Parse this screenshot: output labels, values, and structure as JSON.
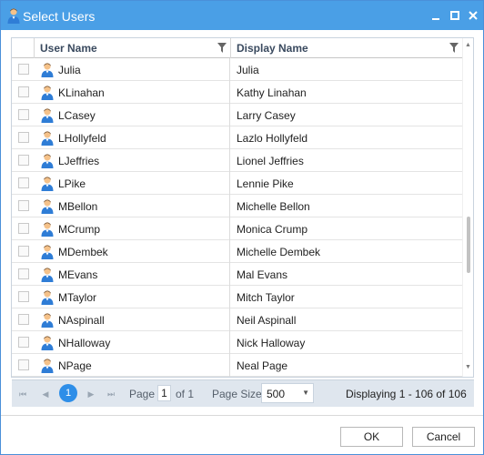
{
  "window": {
    "title": "Select Users"
  },
  "grid": {
    "columns": {
      "user_name": "User Name",
      "display_name": "Display Name"
    },
    "rows": [
      {
        "user": "Julia",
        "display": "Julia"
      },
      {
        "user": "KLinahan",
        "display": "Kathy Linahan"
      },
      {
        "user": "LCasey",
        "display": "Larry Casey"
      },
      {
        "user": "LHollyfeld",
        "display": "Lazlo Hollyfeld"
      },
      {
        "user": "LJeffries",
        "display": "Lionel Jeffries"
      },
      {
        "user": "LPike",
        "display": "Lennie Pike"
      },
      {
        "user": "MBellon",
        "display": "Michelle Bellon"
      },
      {
        "user": "MCrump",
        "display": "Monica Crump"
      },
      {
        "user": "MDembek",
        "display": "Michelle Dembek"
      },
      {
        "user": "MEvans",
        "display": "Mal Evans"
      },
      {
        "user": "MTaylor",
        "display": "Mitch Taylor"
      },
      {
        "user": "NAspinall",
        "display": "Neil Aspinall"
      },
      {
        "user": "NHalloway",
        "display": "Nick Halloway"
      },
      {
        "user": "NPage",
        "display": "Neal Page"
      }
    ]
  },
  "pager": {
    "current_page": "1",
    "page_label": "Page",
    "page_input": "1",
    "of_label": "of 1",
    "page_size_label": "Page Size:",
    "page_size_value": "500",
    "displaying": "Displaying 1 - 106 of 106"
  },
  "footer": {
    "ok_label": "OK",
    "cancel_label": "Cancel"
  },
  "colors": {
    "titlebar": "#4a9fe6",
    "accent": "#2e8ee8",
    "pager_bg": "#dfe6ee"
  }
}
